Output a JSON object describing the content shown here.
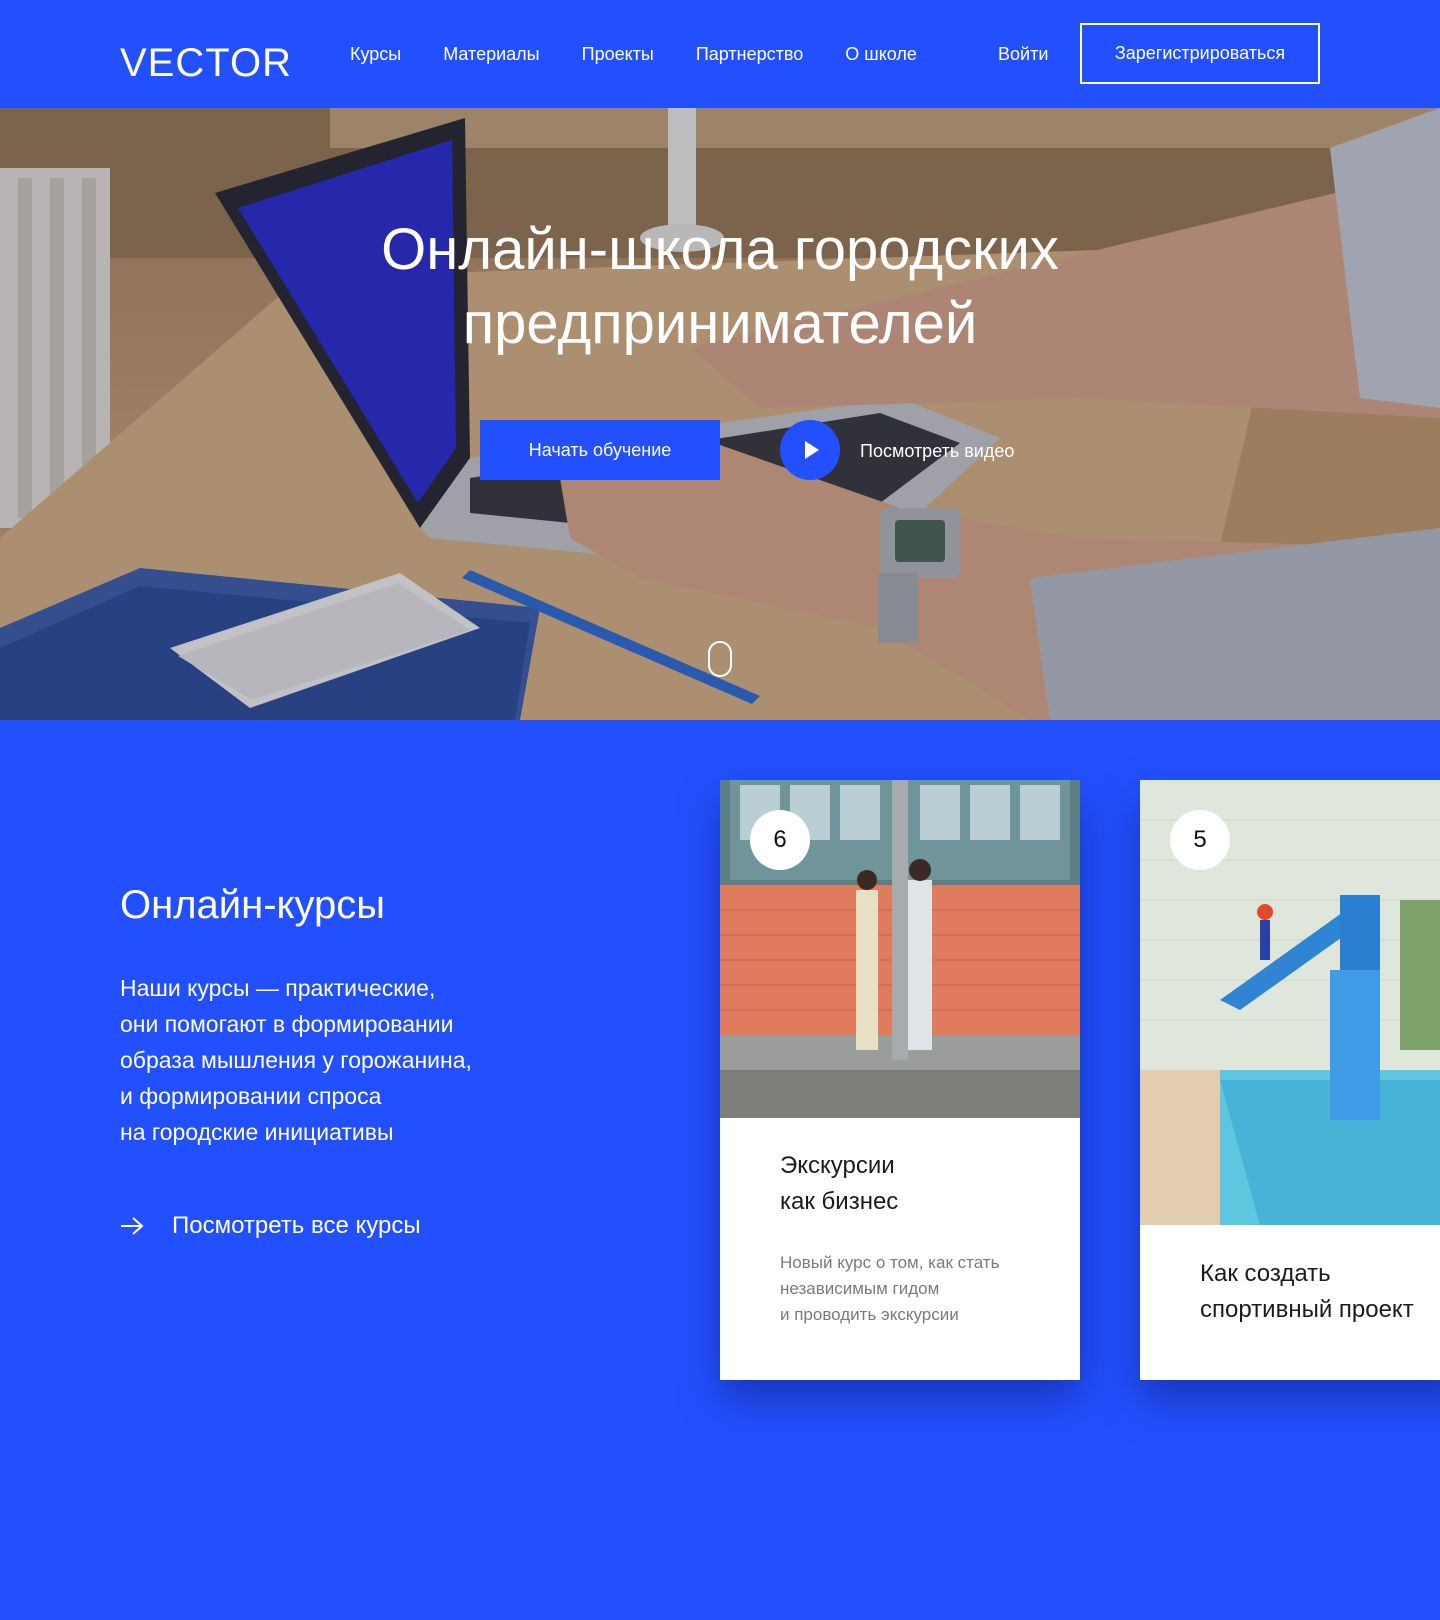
{
  "header": {
    "logo": "VECTOR",
    "nav": [
      "Курсы",
      "Материалы",
      "Проекты",
      "Партнерство",
      "О школе"
    ],
    "login": "Войти",
    "register": "Зарегистрироваться"
  },
  "hero": {
    "title": "Онлайн-школа городских\nпредпринимателей",
    "start_button": "Начать обучение",
    "video_link": "Посмотреть видео"
  },
  "courses": {
    "title": "Онлайн-курсы",
    "description": "Наши курсы — практические,\nони помогают в формировании\nобраза мышления у горожанина,\nи формировании спроса\nна городские инициативы",
    "all_link": "Посмотреть все курсы",
    "cards": [
      {
        "badge": "6",
        "title": "Экскурсии\nкак бизнес",
        "text": "Новый курс о том, как стать\nнезависимым гидом\nи проводить экскурсии"
      },
      {
        "badge": "5",
        "title": "Как создать\nспортивный проект",
        "text": ""
      }
    ]
  },
  "colors": {
    "accent": "#2350ff",
    "white": "#ffffff"
  }
}
